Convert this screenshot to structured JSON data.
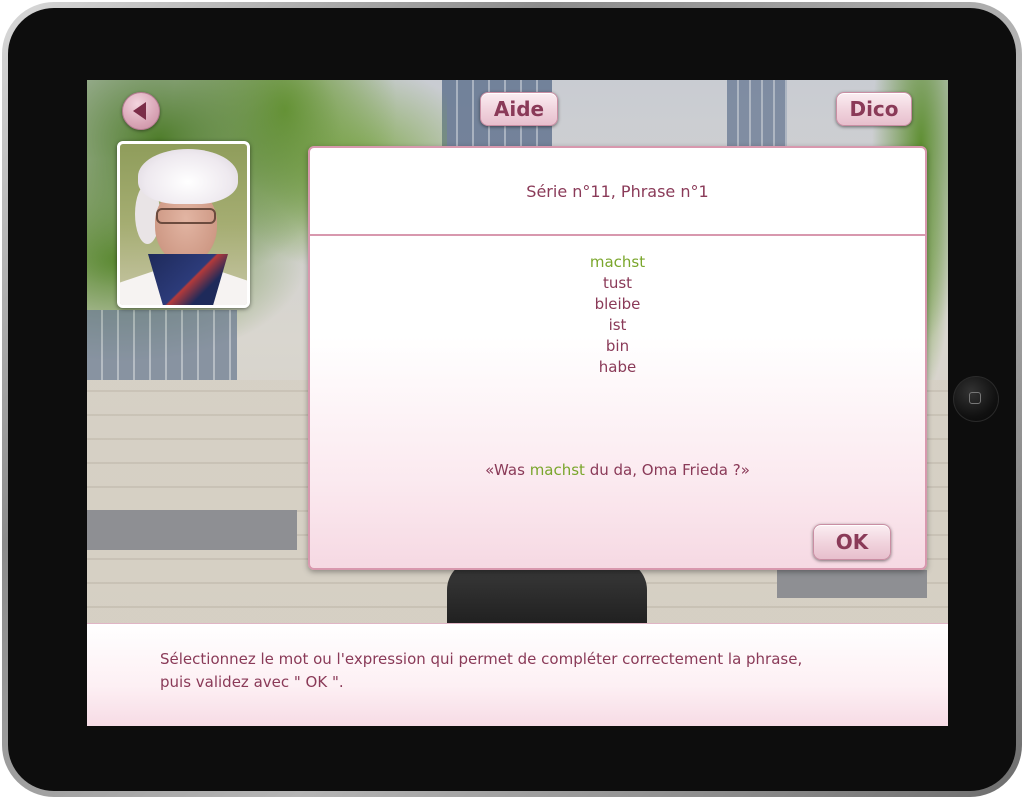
{
  "header": {
    "back_icon": "back-arrow-icon",
    "aide_label": "Aide",
    "dico_label": "Dico"
  },
  "exercise": {
    "title": "Série n°11, Phrase n°1",
    "options": [
      "machst",
      "tust",
      "bleibe",
      "ist",
      "bin",
      "habe"
    ],
    "selected_option": "machst",
    "sentence_before": "«Was ",
    "sentence_answer": "machst",
    "sentence_after": " du da, Oma Frieda ?»",
    "ok_label": "OK"
  },
  "instructions": {
    "line1": "Sélectionnez le mot ou l'expression qui permet de compléter correctement la phrase,",
    "line2": "puis validez avec \" OK \"."
  },
  "colors": {
    "accent_text": "#8a3a58",
    "selected_green": "#7aa62c",
    "panel_border": "#d898ae"
  }
}
